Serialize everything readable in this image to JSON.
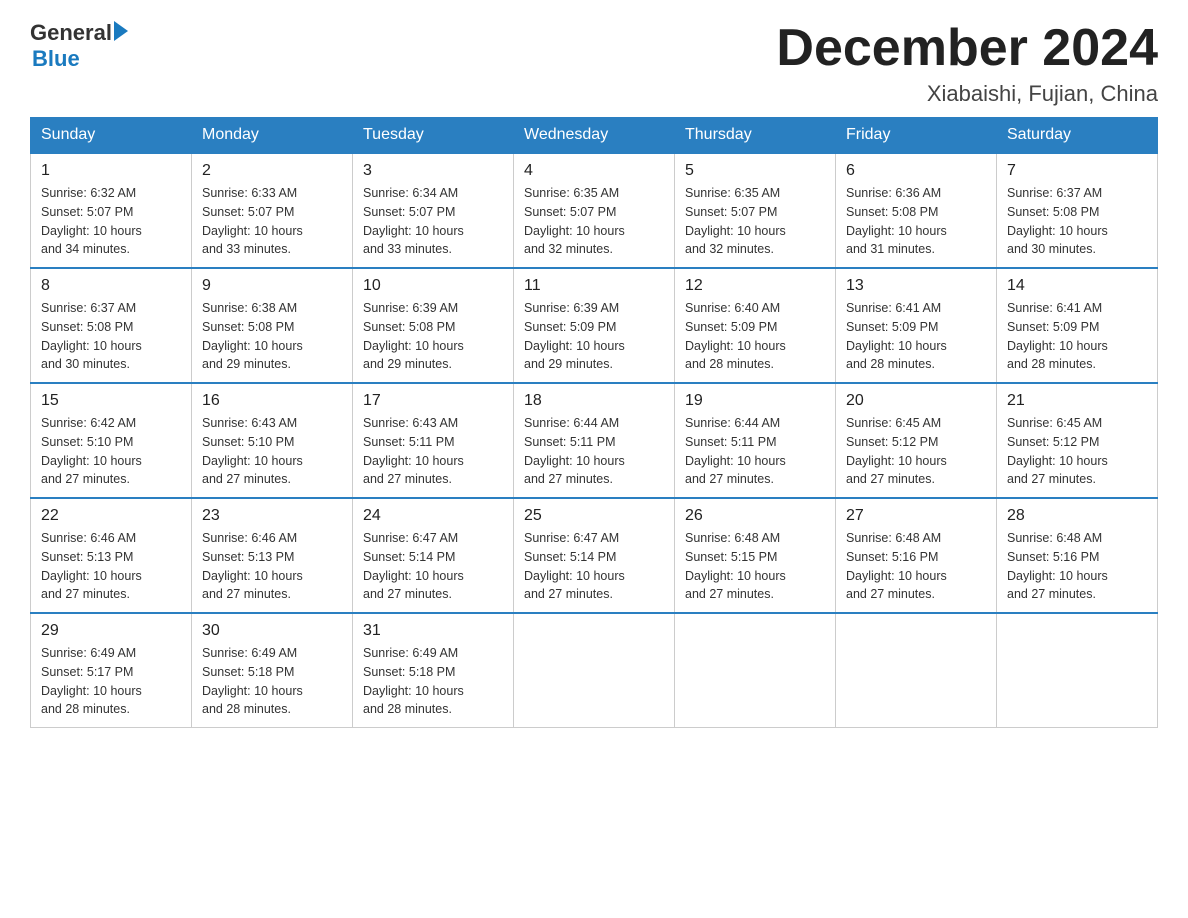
{
  "header": {
    "logo_general": "General",
    "logo_blue": "Blue",
    "month_title": "December 2024",
    "location": "Xiabaishi, Fujian, China"
  },
  "days_of_week": [
    "Sunday",
    "Monday",
    "Tuesday",
    "Wednesday",
    "Thursday",
    "Friday",
    "Saturday"
  ],
  "weeks": [
    [
      {
        "day": "1",
        "sunrise": "6:32 AM",
        "sunset": "5:07 PM",
        "daylight": "10 hours and 34 minutes."
      },
      {
        "day": "2",
        "sunrise": "6:33 AM",
        "sunset": "5:07 PM",
        "daylight": "10 hours and 33 minutes."
      },
      {
        "day": "3",
        "sunrise": "6:34 AM",
        "sunset": "5:07 PM",
        "daylight": "10 hours and 33 minutes."
      },
      {
        "day": "4",
        "sunrise": "6:35 AM",
        "sunset": "5:07 PM",
        "daylight": "10 hours and 32 minutes."
      },
      {
        "day": "5",
        "sunrise": "6:35 AM",
        "sunset": "5:07 PM",
        "daylight": "10 hours and 32 minutes."
      },
      {
        "day": "6",
        "sunrise": "6:36 AM",
        "sunset": "5:08 PM",
        "daylight": "10 hours and 31 minutes."
      },
      {
        "day": "7",
        "sunrise": "6:37 AM",
        "sunset": "5:08 PM",
        "daylight": "10 hours and 30 minutes."
      }
    ],
    [
      {
        "day": "8",
        "sunrise": "6:37 AM",
        "sunset": "5:08 PM",
        "daylight": "10 hours and 30 minutes."
      },
      {
        "day": "9",
        "sunrise": "6:38 AM",
        "sunset": "5:08 PM",
        "daylight": "10 hours and 29 minutes."
      },
      {
        "day": "10",
        "sunrise": "6:39 AM",
        "sunset": "5:08 PM",
        "daylight": "10 hours and 29 minutes."
      },
      {
        "day": "11",
        "sunrise": "6:39 AM",
        "sunset": "5:09 PM",
        "daylight": "10 hours and 29 minutes."
      },
      {
        "day": "12",
        "sunrise": "6:40 AM",
        "sunset": "5:09 PM",
        "daylight": "10 hours and 28 minutes."
      },
      {
        "day": "13",
        "sunrise": "6:41 AM",
        "sunset": "5:09 PM",
        "daylight": "10 hours and 28 minutes."
      },
      {
        "day": "14",
        "sunrise": "6:41 AM",
        "sunset": "5:09 PM",
        "daylight": "10 hours and 28 minutes."
      }
    ],
    [
      {
        "day": "15",
        "sunrise": "6:42 AM",
        "sunset": "5:10 PM",
        "daylight": "10 hours and 27 minutes."
      },
      {
        "day": "16",
        "sunrise": "6:43 AM",
        "sunset": "5:10 PM",
        "daylight": "10 hours and 27 minutes."
      },
      {
        "day": "17",
        "sunrise": "6:43 AM",
        "sunset": "5:11 PM",
        "daylight": "10 hours and 27 minutes."
      },
      {
        "day": "18",
        "sunrise": "6:44 AM",
        "sunset": "5:11 PM",
        "daylight": "10 hours and 27 minutes."
      },
      {
        "day": "19",
        "sunrise": "6:44 AM",
        "sunset": "5:11 PM",
        "daylight": "10 hours and 27 minutes."
      },
      {
        "day": "20",
        "sunrise": "6:45 AM",
        "sunset": "5:12 PM",
        "daylight": "10 hours and 27 minutes."
      },
      {
        "day": "21",
        "sunrise": "6:45 AM",
        "sunset": "5:12 PM",
        "daylight": "10 hours and 27 minutes."
      }
    ],
    [
      {
        "day": "22",
        "sunrise": "6:46 AM",
        "sunset": "5:13 PM",
        "daylight": "10 hours and 27 minutes."
      },
      {
        "day": "23",
        "sunrise": "6:46 AM",
        "sunset": "5:13 PM",
        "daylight": "10 hours and 27 minutes."
      },
      {
        "day": "24",
        "sunrise": "6:47 AM",
        "sunset": "5:14 PM",
        "daylight": "10 hours and 27 minutes."
      },
      {
        "day": "25",
        "sunrise": "6:47 AM",
        "sunset": "5:14 PM",
        "daylight": "10 hours and 27 minutes."
      },
      {
        "day": "26",
        "sunrise": "6:48 AM",
        "sunset": "5:15 PM",
        "daylight": "10 hours and 27 minutes."
      },
      {
        "day": "27",
        "sunrise": "6:48 AM",
        "sunset": "5:16 PM",
        "daylight": "10 hours and 27 minutes."
      },
      {
        "day": "28",
        "sunrise": "6:48 AM",
        "sunset": "5:16 PM",
        "daylight": "10 hours and 27 minutes."
      }
    ],
    [
      {
        "day": "29",
        "sunrise": "6:49 AM",
        "sunset": "5:17 PM",
        "daylight": "10 hours and 28 minutes."
      },
      {
        "day": "30",
        "sunrise": "6:49 AM",
        "sunset": "5:18 PM",
        "daylight": "10 hours and 28 minutes."
      },
      {
        "day": "31",
        "sunrise": "6:49 AM",
        "sunset": "5:18 PM",
        "daylight": "10 hours and 28 minutes."
      },
      null,
      null,
      null,
      null
    ]
  ],
  "labels": {
    "sunrise": "Sunrise:",
    "sunset": "Sunset:",
    "daylight": "Daylight:"
  }
}
